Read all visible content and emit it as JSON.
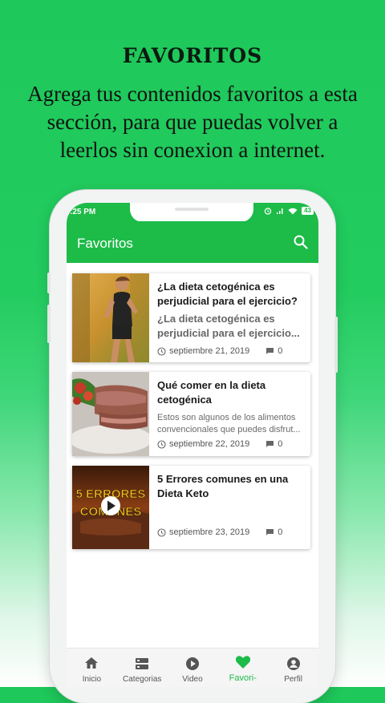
{
  "promo": {
    "title": "FAVORITOS",
    "subtitle": "Agrega tus contenidos favoritos a esta sección, para que puedas volver a leerlos sin conexion a internet."
  },
  "status_bar": {
    "time": ":25 PM",
    "battery": "43"
  },
  "app_bar": {
    "title": "Favoritos",
    "search_icon": "search-icon"
  },
  "articles": [
    {
      "title": "¿La dieta cetogénica es perjudicial para el ejercicio?",
      "excerpt": "¿La dieta cetogénica es perjudicial para el ejercicio...",
      "date": "septiembre 21, 2019",
      "comments": "0"
    },
    {
      "title": "Qué comer en la dieta cetogénica",
      "excerpt": "Estos son algunos de los alimentos convencionales que puedes disfrut...",
      "date": "septiembre 22, 2019",
      "comments": "0"
    },
    {
      "title": "5 Errores comunes en una Dieta Keto",
      "excerpt": "",
      "date": "septiembre 23, 2019",
      "comments": "0",
      "thumb_text_1": "5 ERRORES",
      "thumb_text_2": "COMUNES"
    }
  ],
  "bottom_nav": [
    {
      "label": "Inicio",
      "icon": "home-icon"
    },
    {
      "label": "Categorias",
      "icon": "categories-icon"
    },
    {
      "label": "Video",
      "icon": "play-circle-icon"
    },
    {
      "label": "Favori-",
      "icon": "heart-icon",
      "active": true
    },
    {
      "label": "Perfil",
      "icon": "account-icon"
    }
  ],
  "colors": {
    "brand_green": "#1dbb48",
    "bg_green": "#22cc5e"
  }
}
